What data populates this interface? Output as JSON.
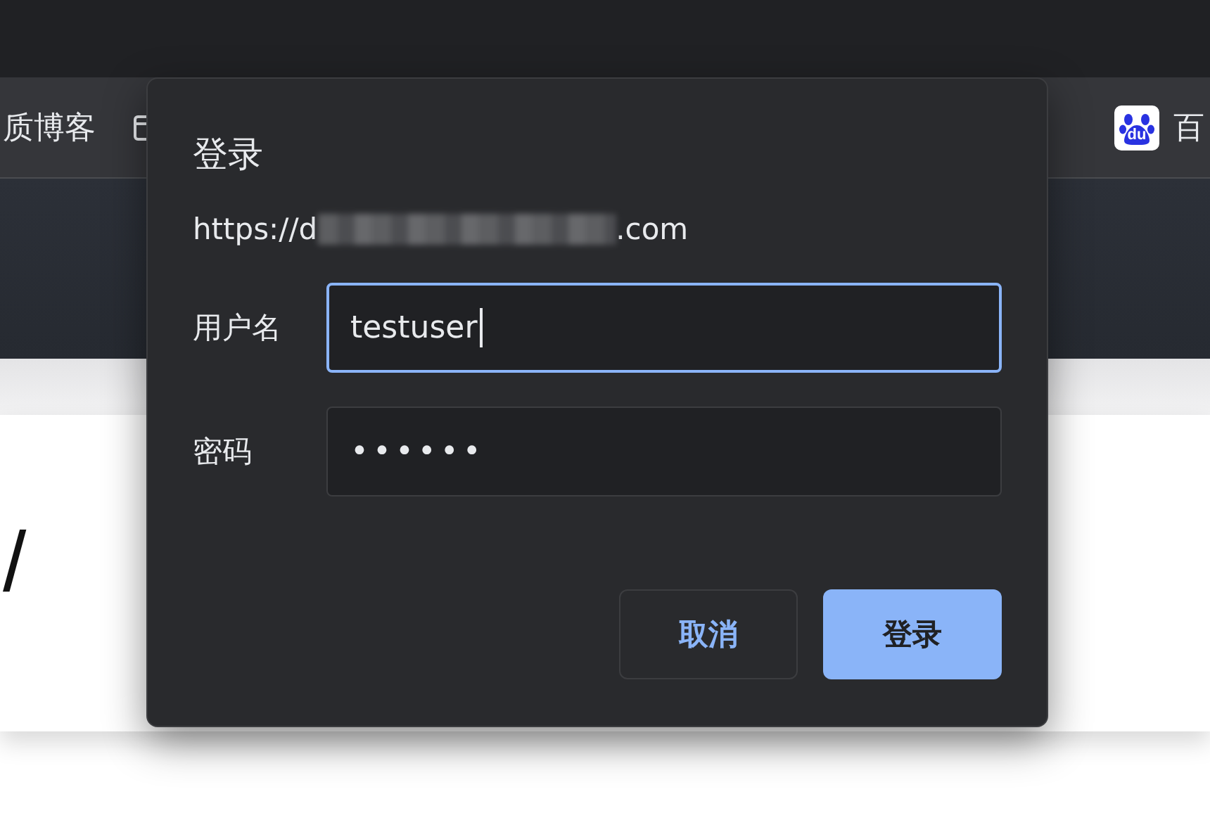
{
  "bookmarks_bar": {
    "items": [
      {
        "kind": "text",
        "label": "质博客"
      },
      {
        "kind": "folder"
      },
      {
        "kind": "baidu",
        "logo_text": "du",
        "label": "百"
      }
    ]
  },
  "page": {
    "text": "/"
  },
  "dialog": {
    "title": "登录",
    "origin": {
      "start": "https://d",
      "end": ".com",
      "redacted": true
    },
    "fields": [
      {
        "label": "用户名",
        "value": "testuser",
        "kind": "text",
        "focused": true
      },
      {
        "label": "密码",
        "value": "••••••",
        "kind": "password",
        "focused": false
      }
    ],
    "buttons": [
      {
        "label": "取消",
        "kind": "secondary"
      },
      {
        "label": "登录",
        "kind": "primary"
      }
    ]
  }
}
